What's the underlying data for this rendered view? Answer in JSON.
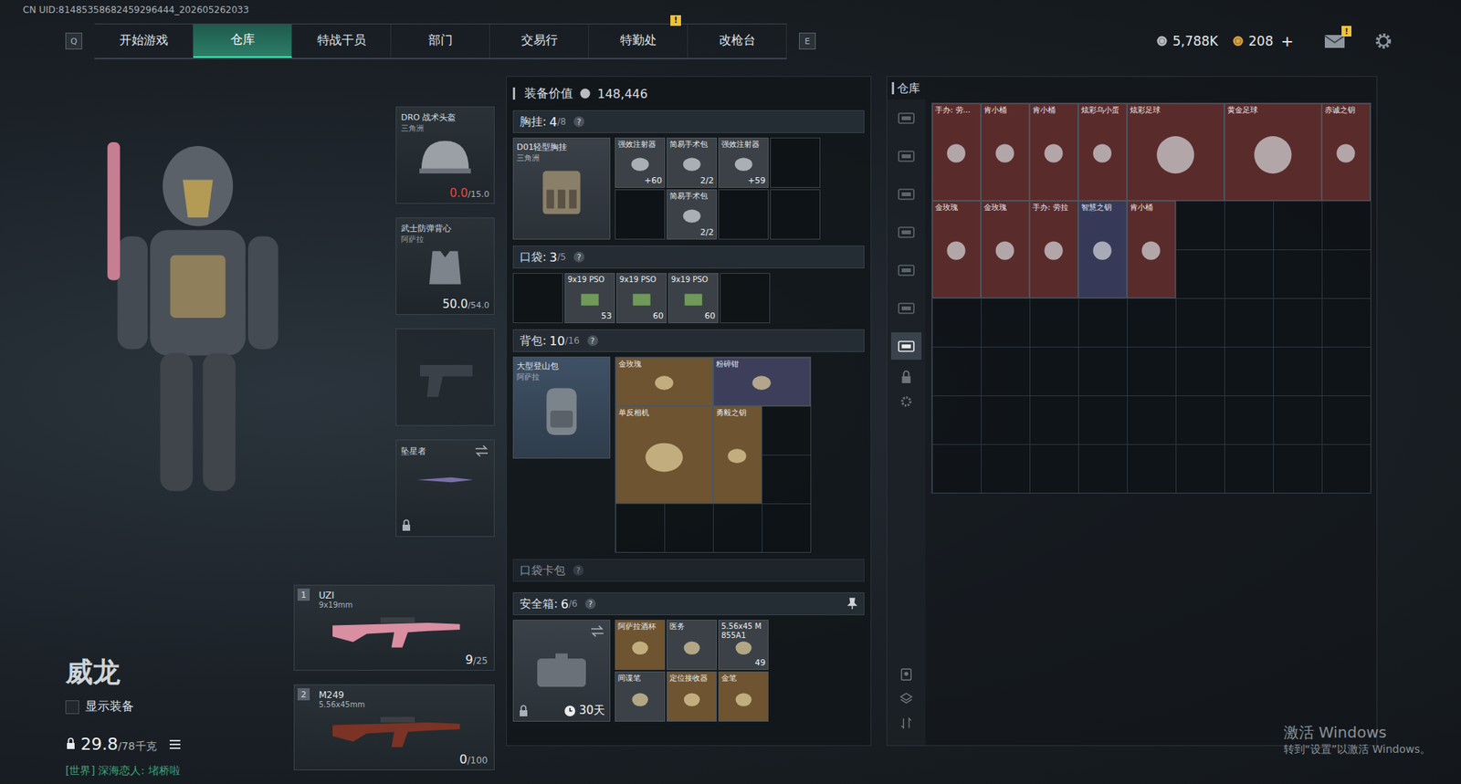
{
  "uid": "CN UID:81485358682459296444_202605262033",
  "nav": {
    "prev_key": "Q",
    "next_key": "E",
    "tabs": [
      {
        "label": "开始游戏",
        "selected": false,
        "badge": ""
      },
      {
        "label": "仓库",
        "selected": true,
        "badge": ""
      },
      {
        "label": "特战干员",
        "selected": false,
        "badge": ""
      },
      {
        "label": "部门",
        "selected": false,
        "badge": ""
      },
      {
        "label": "交易行",
        "selected": false,
        "badge": ""
      },
      {
        "label": "特勤处",
        "selected": false,
        "badge": "!"
      },
      {
        "label": "改枪台",
        "selected": false,
        "badge": ""
      }
    ]
  },
  "wallet": {
    "currencies": [
      {
        "value": "5,788K",
        "color": "#b9bdc1"
      },
      {
        "value": "208",
        "color": "#d9a441"
      }
    ],
    "add": "+",
    "mail_badge": "!"
  },
  "operator": {
    "name": "威龙",
    "show_gear": {
      "label": "显示装备",
      "checked": false
    },
    "weight": "29.8",
    "weight_max": "/78千克",
    "chat": "[世界] 深海恋人: 堵桥啦"
  },
  "gear": {
    "helmet": {
      "name": "DRO 战术头盔",
      "origin": "三角洲",
      "reading": "0.0",
      "max": "/15.0",
      "broken": true
    },
    "armor": {
      "name": "武士防弹背心",
      "origin": "阿萨拉",
      "reading": "50.0",
      "max": "/54.0",
      "broken": false
    },
    "pistol": {
      "empty": true
    },
    "melee": {
      "name": "坠星者",
      "locked": true
    }
  },
  "weapons": [
    {
      "slot": "1",
      "name": "UZI",
      "caliber": "9x19mm",
      "ammo": "9",
      "capacity": "/25",
      "color": "#d98ea2"
    },
    {
      "slot": "2",
      "name": "M249",
      "caliber": "5.56x45mm",
      "ammo": "0",
      "capacity": "/100",
      "color": "#7a3324"
    }
  ],
  "loadout": {
    "label": "装备价值",
    "value": "148,446",
    "chest": {
      "title": "胸挂:",
      "used": "4",
      "total": "/8",
      "help": "?",
      "container": {
        "name": "D01轻型胸挂",
        "origin": "三角洲"
      },
      "slots": [
        {
          "label": "强效注射器",
          "count": "+60",
          "kind": "small",
          "color": "#3b4147"
        },
        {
          "label": "简易手术包",
          "count": "2/2",
          "kind": "small",
          "color": "#3b4147"
        },
        {
          "label": "强效注射器",
          "count": "+59",
          "kind": "small",
          "color": "#3b4147"
        },
        null,
        null,
        {
          "label": "简易手术包",
          "count": "2/2",
          "kind": "small",
          "color": "#3b4147"
        },
        null,
        null
      ]
    },
    "pockets": {
      "title": "口袋:",
      "used": "3",
      "total": "/5",
      "help": "?",
      "slots": [
        null,
        {
          "label": "9x19 PSO",
          "count": "53",
          "kind": "small",
          "color": "#3b4147"
        },
        {
          "label": "9x19 PSO",
          "count": "60",
          "kind": "small",
          "color": "#3b4147"
        },
        {
          "label": "9x19 PSO",
          "count": "60",
          "kind": "small",
          "color": "#3b4147"
        },
        null
      ]
    },
    "backpack": {
      "title": "背包:",
      "used": "10",
      "total": "/16",
      "help": "?",
      "container": {
        "name": "大型登山包",
        "origin": "阿萨拉"
      },
      "items": [
        {
          "label": "金玫瑰",
          "count": "",
          "kind": "wide",
          "color": "#6e5431"
        },
        {
          "label": "粉碎钳",
          "count": "",
          "kind": "wide",
          "color": "#3d3f5a"
        },
        {
          "label": "单反相机",
          "count": "",
          "kind": "big",
          "color": "#6e5431"
        },
        {
          "label": "勇毅之钥",
          "count": "",
          "kind": "tall",
          "color": "#6e5431"
        }
      ]
    },
    "card_pack": {
      "title": "口袋卡包",
      "help": "?"
    },
    "safe": {
      "title": "安全箱:",
      "used": "6",
      "total": "/6",
      "help": "?",
      "timer": "30天",
      "items": [
        {
          "label": "阿萨拉酒杯",
          "count": "",
          "kind": "small",
          "color": "#6e5431"
        },
        {
          "label": "医务",
          "count": "",
          "kind": "small",
          "color": "#3b4147"
        },
        {
          "label": "5.56x45 M855A1",
          "count": "49",
          "kind": "small",
          "color": "#3b4147"
        },
        {
          "label": "间谍笔",
          "count": "",
          "kind": "small",
          "color": "#3b4147"
        },
        {
          "label": "定位接收器",
          "count": "",
          "kind": "small",
          "color": "#6e5431"
        },
        {
          "label": "金笔",
          "count": "",
          "kind": "small",
          "color": "#6e5431"
        }
      ]
    }
  },
  "warehouse": {
    "title": "仓库",
    "tabs": [
      {
        "selected": false
      },
      {
        "selected": false
      },
      {
        "selected": false
      },
      {
        "selected": false
      },
      {
        "selected": false
      },
      {
        "selected": false
      },
      {
        "selected": true
      }
    ],
    "items": [
      {
        "label": "手办: 劳...",
        "count": "",
        "kind": "tall",
        "color": "#5a2b2b"
      },
      {
        "label": "肯小桶",
        "count": "",
        "kind": "tall",
        "color": "#5a2b2b"
      },
      {
        "label": "肯小桶",
        "count": "",
        "kind": "tall",
        "color": "#5a2b2b"
      },
      {
        "label": "炫彩乌小蛋",
        "count": "",
        "kind": "tall",
        "color": "#5a2b2b"
      },
      {
        "label": "炫彩足球",
        "count": "",
        "kind": "big",
        "color": "#5a2b2b"
      },
      {
        "label": "黄金足球",
        "count": "",
        "kind": "big",
        "color": "#5a2b2b"
      },
      {
        "label": "赤诚之钥",
        "count": "",
        "kind": "tall",
        "color": "#5a2b2b"
      },
      {
        "label": "金玫瑰",
        "count": "",
        "kind": "tall",
        "color": "#5a2b2b"
      },
      {
        "label": "金玫瑰",
        "count": "",
        "kind": "tall",
        "color": "#5a2b2b"
      },
      {
        "label": "手办: 劳拉",
        "count": "",
        "kind": "tall",
        "color": "#5a2b2b"
      },
      {
        "label": "智慧之钥",
        "count": "",
        "kind": "tall",
        "color": "#363a58"
      },
      {
        "label": "肯小桶",
        "count": "",
        "kind": "tall",
        "color": "#5a2b2b"
      }
    ]
  },
  "activation": {
    "title": "激活 Windows",
    "hint": "转到“设置”以激活 Windows。"
  }
}
